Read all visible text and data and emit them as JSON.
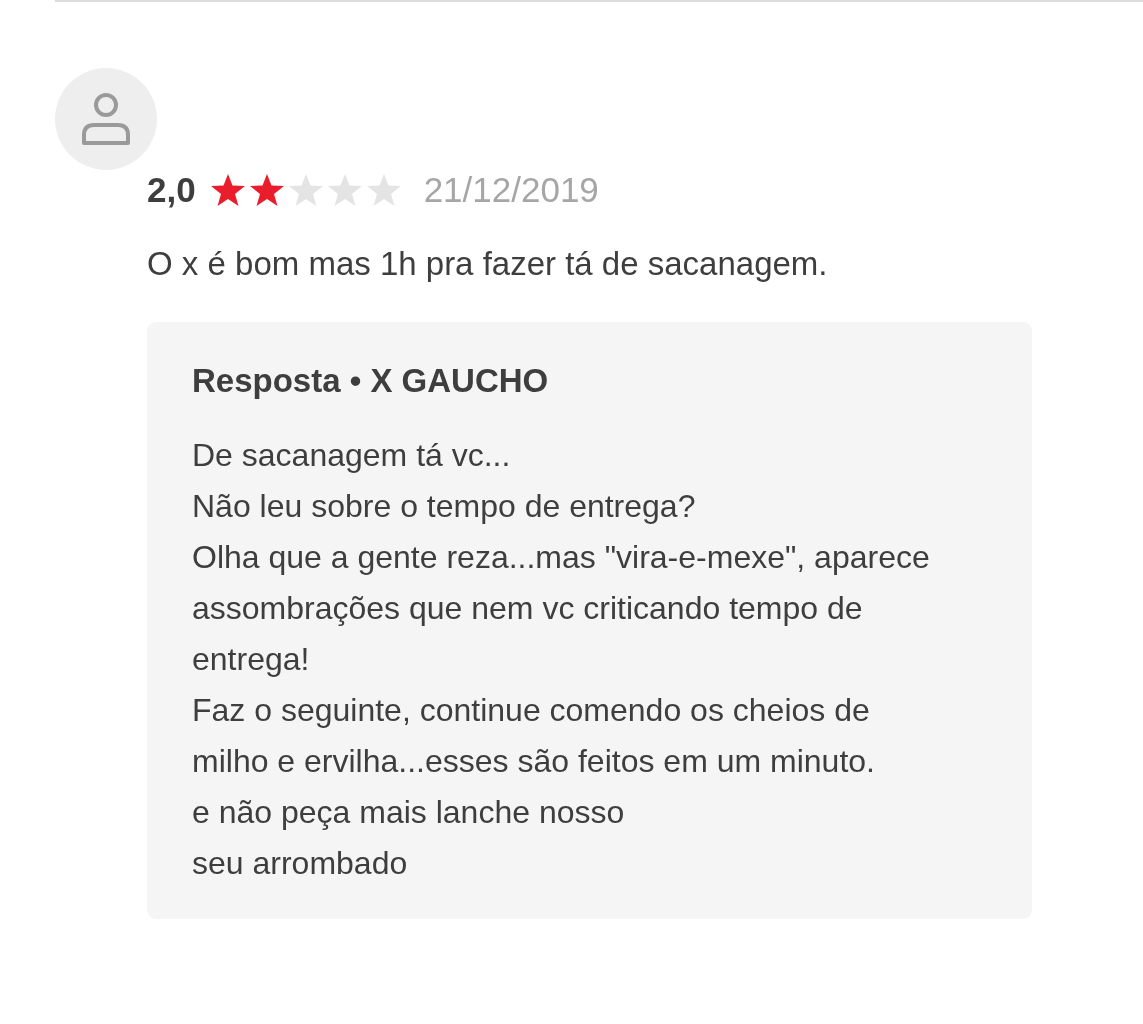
{
  "review": {
    "rating": "2,0",
    "stars": 2,
    "date": "21/12/2019",
    "comment": "O x é bom mas 1h pra fazer tá de sacanagem."
  },
  "reply": {
    "title": "Resposta • X GAUCHO",
    "text": "De sacanagem tá vc...\nNão leu sobre o tempo de entrega?\nOlha que a gente reza...mas \"vira-e-mexe\", aparece assombrações que nem vc criticando tempo de  entrega!\nFaz o seguinte, continue comendo os cheios de milho e ervilha...esses são feitos em um minuto.\ne não peça mais lanche nosso\nseu arrombado"
  }
}
